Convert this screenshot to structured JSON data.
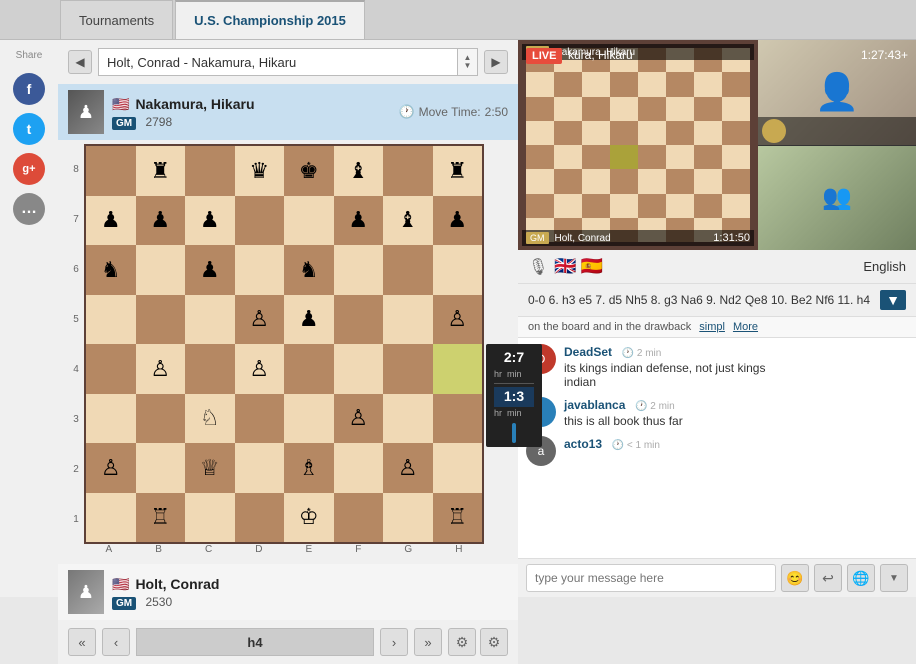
{
  "tabs": [
    {
      "id": "tournaments",
      "label": "Tournaments",
      "active": false
    },
    {
      "id": "uschamp2015",
      "label": "U.S. Championship 2015",
      "active": true
    }
  ],
  "share": {
    "label": "Share",
    "social": [
      {
        "id": "facebook",
        "symbol": "f",
        "class": "fb"
      },
      {
        "id": "twitter",
        "symbol": "t",
        "class": "tw"
      },
      {
        "id": "googleplus",
        "symbol": "g+",
        "class": "gp"
      },
      {
        "id": "more",
        "symbol": "…",
        "class": "more"
      }
    ]
  },
  "game_selector": {
    "game_name": "Holt, Conrad - Nakamura, Hikaru",
    "prev_label": "◀",
    "next_label": "▶"
  },
  "players": {
    "top": {
      "name": "Nakamura, Hikaru",
      "flag": "🇺🇸",
      "title": "GM",
      "rating": "2798",
      "move_time_label": "Move Time:",
      "move_time": "2:50"
    },
    "bottom": {
      "name": "Holt, Conrad",
      "flag": "🇺🇸",
      "title": "GM",
      "rating": "2530"
    }
  },
  "board": {
    "ranks": [
      "8",
      "7",
      "6",
      "5",
      "4",
      "3",
      "2",
      "1"
    ],
    "files": [
      "A",
      "B",
      "C",
      "D",
      "E",
      "F",
      "G",
      "H"
    ],
    "squares": [
      "dark",
      "light",
      "dark",
      "light",
      "dark",
      "light",
      "dark",
      "light",
      "light",
      "dark",
      "light",
      "dark",
      "light",
      "dark",
      "light",
      "dark",
      "dark",
      "light",
      "dark",
      "light",
      "dark",
      "light",
      "dark",
      "light",
      "light",
      "dark",
      "light",
      "dark",
      "light",
      "dark",
      "light",
      "dark",
      "dark",
      "light",
      "dark",
      "light",
      "dark",
      "light",
      "dark",
      "light",
      "light",
      "dark",
      "light",
      "dark",
      "light",
      "dark",
      "light",
      "dark",
      "dark",
      "light",
      "dark",
      "light",
      "dark",
      "light",
      "dark",
      "light",
      "light",
      "dark",
      "light",
      "dark",
      "light",
      "dark",
      "light",
      "dark"
    ]
  },
  "board_pieces": {
    "description": "Position mid-game Nakamura vs Holt"
  },
  "clocks": {
    "top": {
      "hr": "2",
      "min": "7",
      "label": "hr  min"
    },
    "bottom": {
      "hr": "1",
      "min": "3",
      "label": "hr  min"
    }
  },
  "move_controls": {
    "first": "«",
    "prev": "‹",
    "current_move": "h4",
    "next": "›",
    "last": "»"
  },
  "live_stream": {
    "live_badge": "LIVE",
    "title": "kura, Hikaru",
    "timer": "1:27:43+",
    "bottom_name": "Holt, Conrad",
    "bottom_time": "1:31:50"
  },
  "lang_row": {
    "mic_icon": "🎙",
    "flags": [
      "🇬🇧",
      "🇪🇸"
    ],
    "language": "English"
  },
  "move_list": {
    "moves": "0-0 6. h3 e5 7. d5 Nh5 8. g3 Na6 9. Nd2 Qe8 10. Be2 Nf6 11. h4",
    "dropdown_icon": "▼"
  },
  "analysis": {
    "text": "on the board and in the drawback",
    "simpl_label": "simpl",
    "more_label": "More"
  },
  "chat": {
    "messages": [
      {
        "id": "msg1",
        "user": "DeadSet",
        "avatar_bg": "#c0392b",
        "avatar_text": "D",
        "time": "2 min",
        "lines": [
          "its kings indian defense, not just kings",
          "indian"
        ]
      },
      {
        "id": "msg2",
        "user": "javablanca",
        "avatar_bg": "#2980b9",
        "avatar_text": "j",
        "time": "2 min",
        "lines": [
          "this is all book thus far"
        ]
      },
      {
        "id": "msg3",
        "user": "acto13",
        "avatar_bg": "#666",
        "avatar_text": "a",
        "time": "< 1 min",
        "lines": []
      }
    ],
    "input_placeholder": "type your message here",
    "emoji_icon": "😊",
    "send_icon": "↩",
    "globe_icon": "🌐"
  }
}
